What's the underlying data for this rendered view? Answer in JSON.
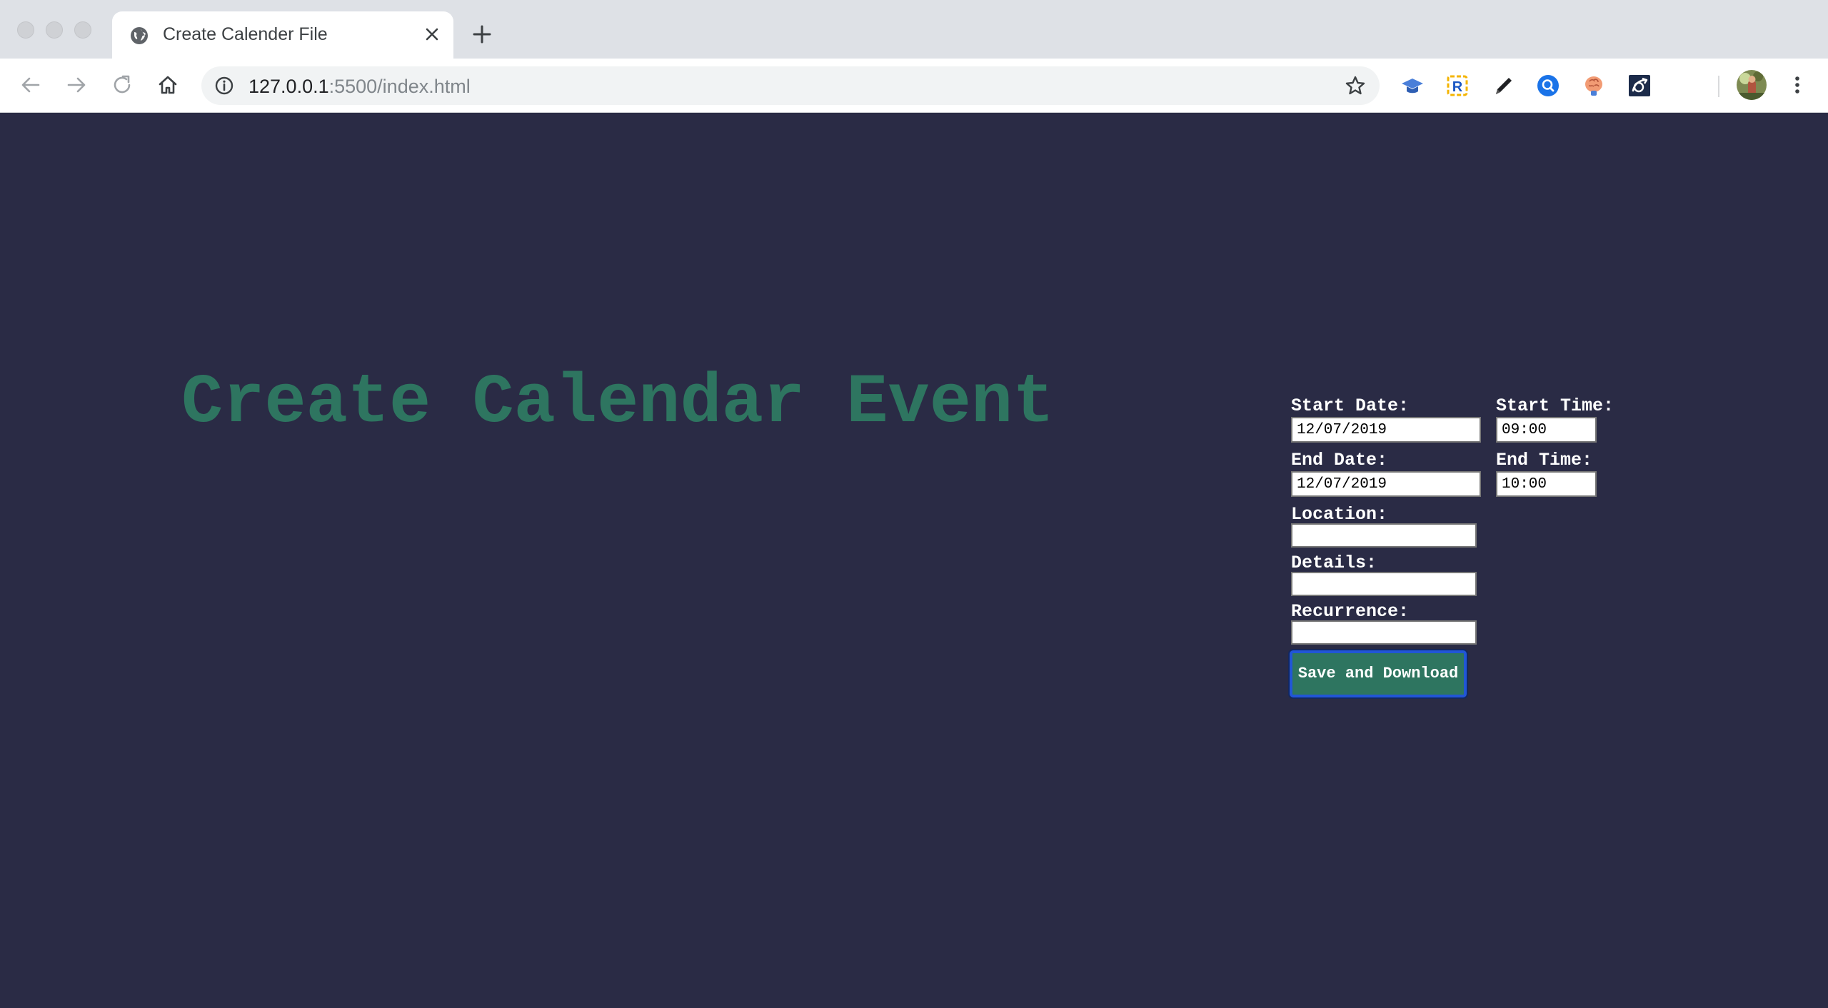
{
  "browser": {
    "tab_title": "Create Calender File",
    "url_host": "127.0.0.1",
    "url_rest": ":5500/index.html"
  },
  "page": {
    "headline": "Create Calendar Event"
  },
  "form": {
    "start_date_label": "Start Date:",
    "start_date_value": "12/07/2019",
    "start_time_label": "Start Time:",
    "start_time_value": "09:00",
    "end_date_label": "End Date:",
    "end_date_value": "12/07/2019",
    "end_time_label": "End Time:",
    "end_time_value": "10:00",
    "location_label": "Location:",
    "location_value": "",
    "details_label": "Details:",
    "details_value": "",
    "recurrence_label": "Recurrence:",
    "recurrence_value": "",
    "submit_label": "Save and Download"
  },
  "icons": {
    "back": "arrow-left-icon",
    "forward": "arrow-right-icon",
    "reload": "reload-icon",
    "home": "home-icon",
    "info": "info-icon",
    "bookmark": "star-icon",
    "menu": "kebab-menu-icon"
  },
  "colors": {
    "page_background": "#2a2b45",
    "headline": "#2e7560",
    "button_fill": "#2e7560",
    "button_focus_ring": "#2156d6"
  }
}
